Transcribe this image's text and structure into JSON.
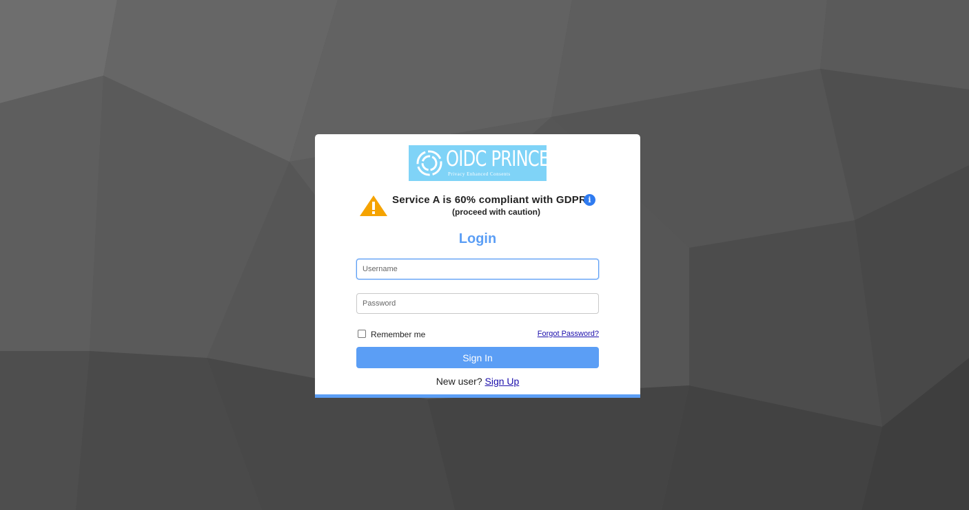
{
  "logo": {
    "title": "OIDC PRINCE",
    "subtitle": "Privacy Enhanced Consents"
  },
  "compliance": {
    "message": "Service A is 60% compliant with GDPR",
    "note": "(proceed with caution)",
    "percent": 60
  },
  "login": {
    "heading": "Login",
    "username_placeholder": "Username",
    "password_placeholder": "Password",
    "remember_label": "Remember me",
    "forgot_label": "Forgot Password?",
    "signin_label": "Sign In",
    "new_user_text": "New user?",
    "signup_label": "Sign Up"
  },
  "colors": {
    "accent": "#5b9ef5",
    "logo_bg": "#7fd3f7",
    "warning": "#f5a300",
    "info": "#2f7bf0",
    "link": "#1a0dab"
  },
  "icons": {
    "warning": "warning-triangle-icon",
    "info": "info-icon"
  }
}
